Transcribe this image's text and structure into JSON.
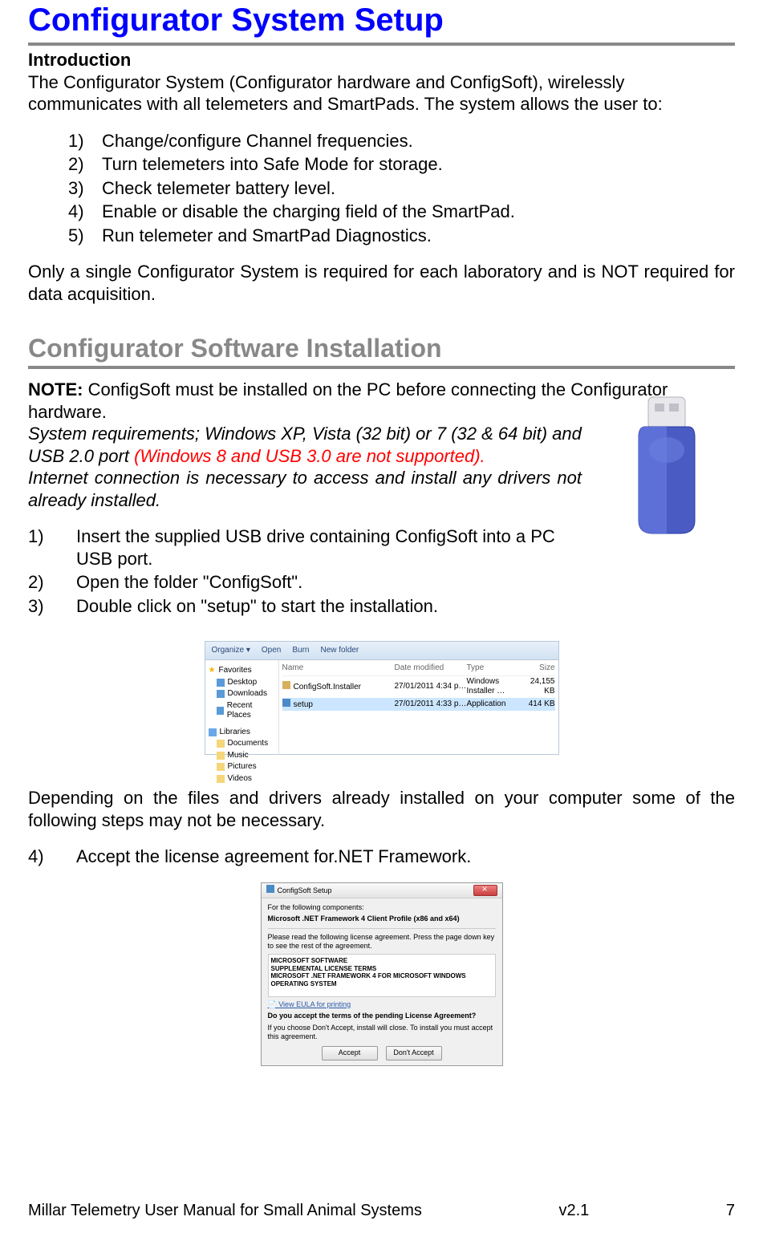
{
  "title": "Configurator System Setup",
  "intro": {
    "heading": "Introduction",
    "para": "The Configurator System (Configurator hardware and ConfigSoft), wirelessly communicates with all telemeters and SmartPads.  The system allows the user to:",
    "items": [
      "Change/configure Channel frequencies.",
      "Turn telemeters into Safe Mode for storage.",
      "Check telemeter battery level.",
      "Enable or disable the charging field of the SmartPad.",
      "Run telemeter and SmartPad Diagnostics."
    ],
    "closing": "Only a single Configurator System is required for each laboratory and is NOT required for data acquisition."
  },
  "install": {
    "heading": "Configurator Software Installation",
    "note_label": "NOTE:",
    "note_text": " ConfigSoft must be installed on the PC before connecting the Configurator hardware.",
    "sys_req1": "System requirements; Windows XP, Vista (32 bit) or 7 (32 & 64 bit) and USB 2.0 port ",
    "sys_req_red": "(Windows 8 and USB 3.0 are not supported).",
    "sys_req2": "Internet connection is necessary to access and install any drivers not already installed.",
    "steps_a": [
      "Insert the supplied USB drive containing ConfigSoft into a PC USB port.",
      "Open the folder \"ConfigSoft\".",
      "Double click on \"setup\" to start the installation."
    ],
    "depending": "Depending on the files and drivers already installed on your computer some of the following steps may not be necessary.",
    "step4_num": "4)",
    "step4_text": "Accept the license agreement for.NET Framework."
  },
  "explorer": {
    "toolbar": {
      "organize": "Organize ▾",
      "open": "Open",
      "burn": "Burn",
      "newfolder": "New folder"
    },
    "nav": {
      "favorites": "Favorites",
      "desktop": "Desktop",
      "downloads": "Downloads",
      "recent": "Recent Places",
      "libraries": "Libraries",
      "documents": "Documents",
      "music": "Music",
      "pictures": "Pictures",
      "videos": "Videos"
    },
    "columns": {
      "name": "Name",
      "date": "Date modified",
      "type": "Type",
      "size": "Size"
    },
    "files": [
      {
        "name": "ConfigSoft.Installer",
        "date": "27/01/2011 4:34 p…",
        "type": "Windows Installer …",
        "size": "24,155 KB"
      },
      {
        "name": "setup",
        "date": "27/01/2011 4:33 p…",
        "type": "Application",
        "size": "414 KB"
      }
    ]
  },
  "installer": {
    "title": "ConfigSoft Setup",
    "for_components": "For the following components:",
    "component": "Microsoft .NET Framework 4 Client Profile (x86 and x64)",
    "read_agreement": "Please read the following license agreement. Press the page down key to see the rest of the agreement.",
    "license_heading1": "MICROSOFT SOFTWARE",
    "license_heading2": "SUPPLEMENTAL LICENSE TERMS",
    "license_heading3": "MICROSOFT .NET FRAMEWORK 4 FOR MICROSOFT WINDOWS OPERATING SYSTEM",
    "view_eula": "View EULA for printing",
    "accept_q": "Do you accept the terms of the pending License Agreement?",
    "dont_accept_note": "If you choose Don't Accept, install will close. To install you must accept this agreement.",
    "btn_accept": "Accept",
    "btn_dont": "Don't Accept"
  },
  "footer": {
    "left": "Millar Telemetry User Manual for Small Animal Systems",
    "center": "v2.1",
    "right": "7"
  }
}
